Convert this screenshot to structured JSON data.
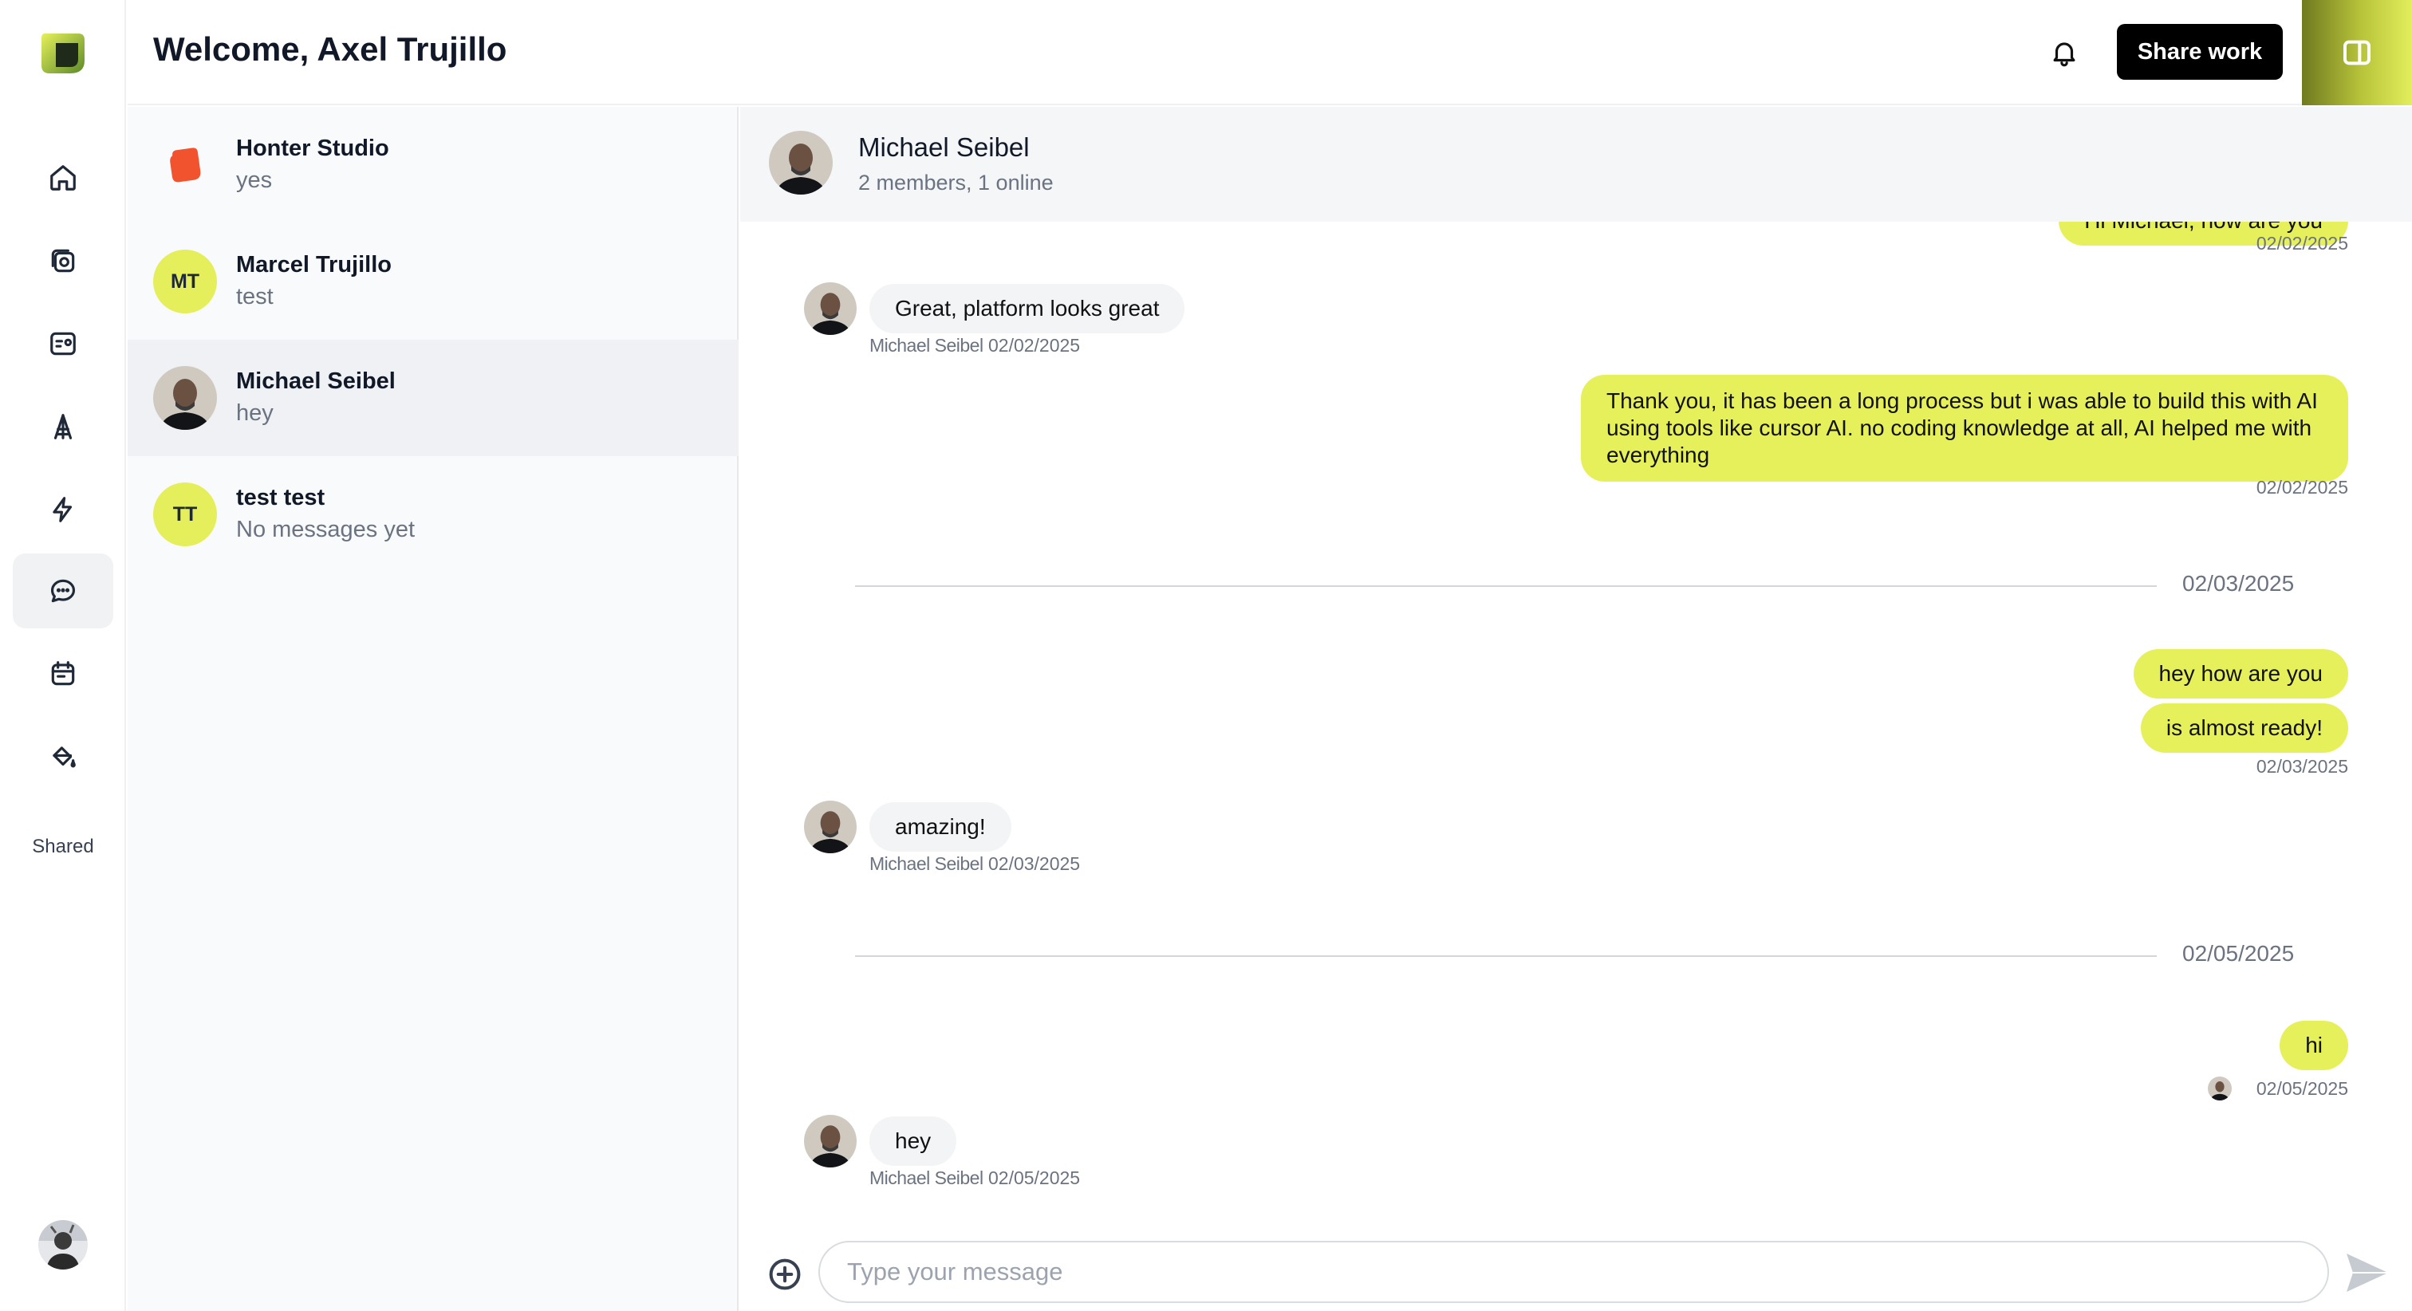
{
  "header": {
    "welcome": "Welcome, Axel Trujillo",
    "share_label": "Share work"
  },
  "rail": {
    "items": [
      {
        "name": "home-icon",
        "active": false
      },
      {
        "name": "gallery-icon",
        "active": false
      },
      {
        "name": "profile-card-icon",
        "active": false
      },
      {
        "name": "tower-icon",
        "active": false
      },
      {
        "name": "lightning-icon",
        "active": false
      },
      {
        "name": "chat-bubble-icon",
        "active": true
      },
      {
        "name": "calendar-icon",
        "active": false
      },
      {
        "name": "paint-bucket-icon",
        "active": false
      }
    ],
    "shared_label": "Shared"
  },
  "conversations": [
    {
      "name": "Honter Studio",
      "preview": "yes",
      "initials": "",
      "avatar": "brand-logo"
    },
    {
      "name": "Marcel Trujillo",
      "preview": "test",
      "initials": "MT",
      "avatar": "initials"
    },
    {
      "name": "Michael Seibel",
      "preview": "hey",
      "initials": "",
      "avatar": "photo",
      "active": true
    },
    {
      "name": "test test",
      "preview": "No messages yet",
      "initials": "TT",
      "avatar": "initials"
    }
  ],
  "chat": {
    "title": "Michael Seibel",
    "subtitle": "2 members, 1 online",
    "messages": {
      "m0": {
        "text": "Hi Michael, how are you",
        "stamp": "02/02/2025"
      },
      "m1": {
        "text": "Great, platform looks great",
        "sender": "Michael Seibel",
        "date": "02/02/2025"
      },
      "m2": {
        "text": "Thank you, it has been a long process but i was able to build this with AI using tools like cursor AI. no coding knowledge at all, AI helped me with everything",
        "stamp": "02/02/2025"
      },
      "d1": {
        "date": "02/03/2025"
      },
      "m3": {
        "text": "hey how are you"
      },
      "m4": {
        "text": "is almost ready!",
        "stamp": "02/03/2025"
      },
      "m5": {
        "text": "amazing!",
        "sender": "Michael Seibel",
        "date": "02/03/2025"
      },
      "d2": {
        "date": "02/05/2025"
      },
      "m6": {
        "text": "hi",
        "stamp": "02/05/2025"
      },
      "m7": {
        "text": "hey",
        "sender": "Michael Seibel",
        "date": "02/05/2025"
      }
    }
  },
  "composer": {
    "placeholder": "Type your message",
    "value": ""
  },
  "colors": {
    "accent_lime": "#e6f05a",
    "brand_orange": "#f0532d",
    "button_dark": "#000000"
  }
}
